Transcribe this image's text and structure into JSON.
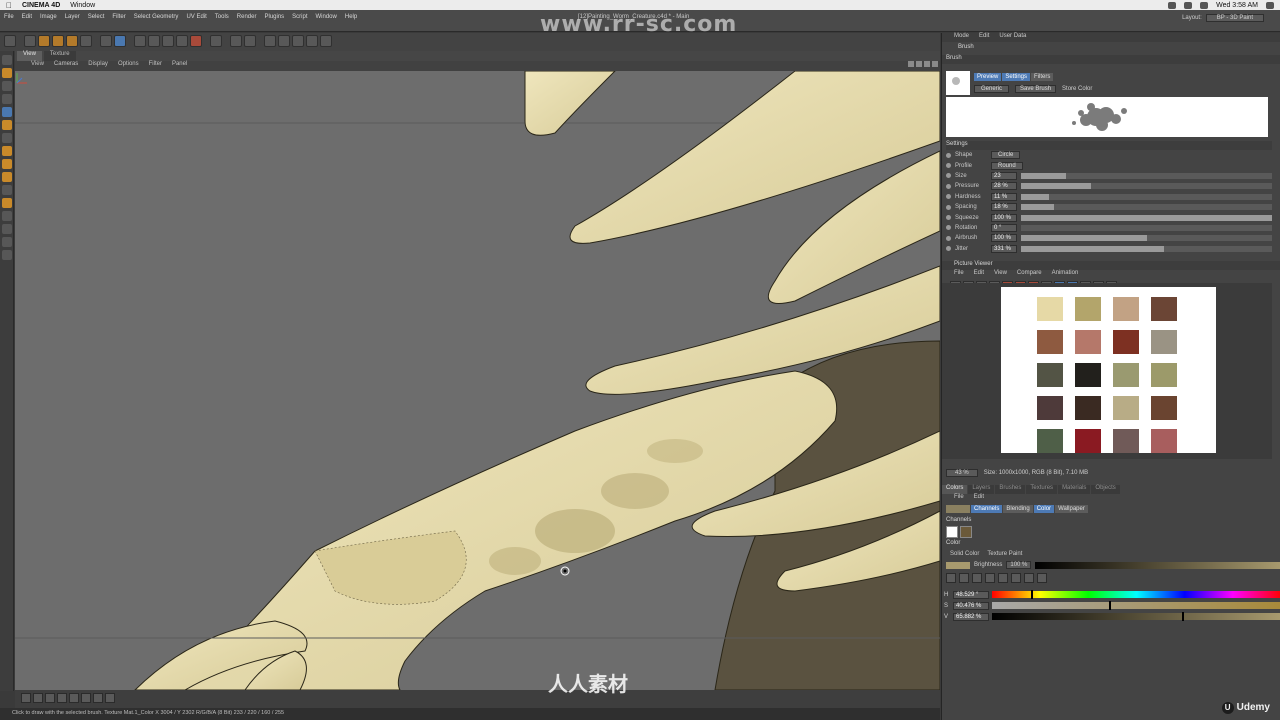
{
  "macos": {
    "app_name": "CINEMA 4D",
    "menu_window": "Window",
    "clock": "Wed 3:58 AM"
  },
  "app": {
    "menus": [
      "File",
      "Edit",
      "Image",
      "Layer",
      "Select",
      "Filter",
      "Select Geometry",
      "UV Edit",
      "Tools",
      "Render",
      "Plugins",
      "Script",
      "Window",
      "Help"
    ],
    "document_title": "[12]Painting_Worm_Creature.c4d * - Main",
    "layout_label": "Layout:",
    "layout_value": "BP - 3D Paint"
  },
  "viewport": {
    "tabs": [
      "View",
      "Texture"
    ],
    "menu": [
      "View",
      "Cameras",
      "Display",
      "Options",
      "Filter",
      "Panel"
    ]
  },
  "status": {
    "text": "Click to draw with the selected brush. Texture Mat.1_Color  X 3004 / Y 2302 R/G/B/A (8 Bit) 233 / 220 / 160 / 255"
  },
  "right_panel": {
    "header_menus": [
      "Mode",
      "Edit",
      "User Data"
    ],
    "brush_title": "Brush",
    "brush_section": "Brush",
    "preview_tabs": [
      "Preview",
      "Settings",
      "Filters"
    ],
    "preset": "Generic",
    "save_brush": "Save Brush",
    "store_color": "Store Color",
    "settings_title": "Settings",
    "shape_label": "Shape",
    "shape_value": "Circle",
    "profile_label": "Profile",
    "profile_value": "Round",
    "settings": [
      {
        "label": "Size",
        "value": "23",
        "level": 0.18
      },
      {
        "label": "Pressure",
        "value": "28 %",
        "level": 0.28
      },
      {
        "label": "Hardness",
        "value": "11 %",
        "level": 0.11
      },
      {
        "label": "Spacing",
        "value": "18 %",
        "level": 0.13
      },
      {
        "label": "Squeeze",
        "value": "100 %",
        "level": 1.0
      },
      {
        "label": "Rotation",
        "value": "0 °",
        "level": 0.0
      },
      {
        "label": "Airbrush",
        "value": "100 %",
        "level": 0.5
      },
      {
        "label": "Jitter",
        "value": "331 %",
        "level": 0.57
      }
    ]
  },
  "picture_viewer": {
    "title": "Picture Viewer",
    "menus": [
      "File",
      "Edit",
      "View",
      "Compare",
      "Animation"
    ],
    "zoom": "43 %",
    "info": "Size: 1000x1000, RGB (8 Bit), 7.10 MB",
    "swatches": [
      [
        "#e6d9a6",
        "#b3a56b",
        "#c2a284",
        "#6b4535"
      ],
      [
        "#8e5a40",
        "#b5786a",
        "#7d3022",
        "#9a9384"
      ],
      [
        "#535445",
        "#22201c",
        "#9a9a70",
        "#9c9a6a"
      ],
      [
        "#4e3a3a",
        "#3a2a22",
        "#b8ac86",
        "#6a4430"
      ],
      [
        "#4f5f48",
        "#8a1a22",
        "#705a58",
        "#a85e5e"
      ]
    ]
  },
  "colors_panel": {
    "tabs": [
      "Colors",
      "Layers",
      "Brushes",
      "Textures",
      "Materials",
      "Objects"
    ],
    "menus": [
      "File",
      "Edit"
    ],
    "sub_tabs": [
      "Channels",
      "Blending",
      "Color",
      "Wallpaper"
    ],
    "channels_title": "Channels",
    "color_title": "Color",
    "solid_color": "Solid Color",
    "texture_paint": "Texture Paint",
    "brightness_label": "Brightness",
    "brightness_value": "100 %",
    "hsv": [
      {
        "key": "H",
        "value": "48.529 °",
        "level": 0.135
      },
      {
        "key": "S",
        "value": "40.476 %",
        "level": 0.405
      },
      {
        "key": "V",
        "value": "65.882 %",
        "level": 0.659
      }
    ]
  },
  "watermark": "www.rr-sc.com",
  "bottom_logo": "人人素材",
  "udemy": "Udemy"
}
